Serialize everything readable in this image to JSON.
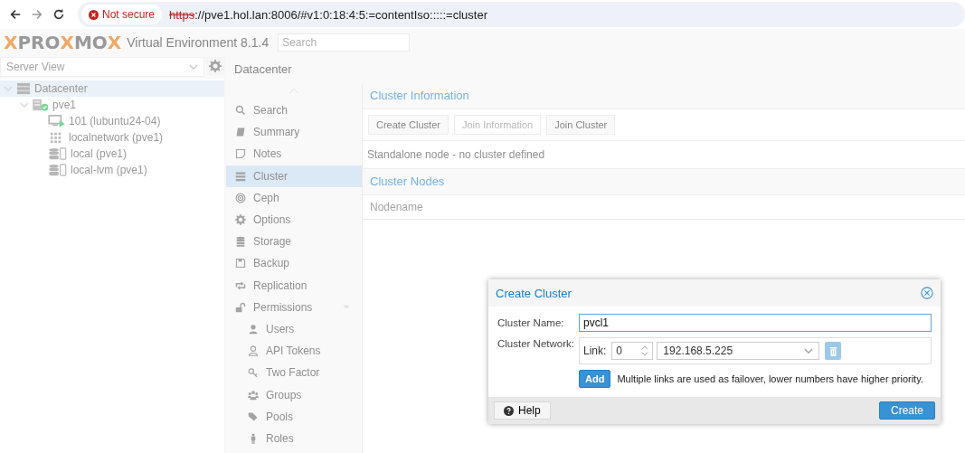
{
  "browser": {
    "security": "Not secure",
    "url_scheme": "https",
    "url_rest": "://pve1.hol.lan:8006/#v1:0:18:4:5:=contentIso:::::=cluster"
  },
  "header": {
    "logo": [
      {
        "text": "X",
        "accent": true
      },
      {
        "text": "PRO",
        "accent": false
      },
      {
        "text": "X",
        "accent": true
      },
      {
        "text": "MO",
        "accent": false
      },
      {
        "text": "X",
        "accent": true
      }
    ],
    "product": "Virtual Environment 8.1.4",
    "search": {
      "placeholder": "Search"
    }
  },
  "sidebar": {
    "view": "Server View",
    "tree": [
      {
        "label": "Datacenter",
        "kind": "datacenter",
        "selected": true,
        "expanded": true,
        "children": [
          {
            "label": "pve1",
            "kind": "node",
            "selected": false,
            "expanded": true,
            "children": [
              {
                "label": "101 (lubuntu24-04)",
                "kind": "vm",
                "selected": false
              },
              {
                "label": "localnetwork (pve1)",
                "kind": "sdn",
                "selected": false
              },
              {
                "label": "local (pve1)",
                "kind": "storage",
                "selected": false
              },
              {
                "label": "local-lvm (pve1)",
                "kind": "storage",
                "selected": false
              }
            ]
          }
        ]
      }
    ]
  },
  "breadcrumb": "Datacenter",
  "nav": [
    {
      "label": "Search",
      "kind": "search",
      "selected": false
    },
    {
      "label": "Summary",
      "kind": "book",
      "selected": false
    },
    {
      "label": "Notes",
      "kind": "note",
      "selected": false
    },
    {
      "label": "Cluster",
      "kind": "server",
      "selected": true
    },
    {
      "label": "Ceph",
      "kind": "ceph",
      "selected": false
    },
    {
      "label": "Options",
      "kind": "gear",
      "selected": false
    },
    {
      "label": "Storage",
      "kind": "database",
      "selected": false
    },
    {
      "label": "Backup",
      "kind": "floppy",
      "selected": false
    },
    {
      "label": "Replication",
      "kind": "retweet",
      "selected": false
    },
    {
      "label": "Permissions",
      "kind": "unlock",
      "selected": false,
      "expanded": true,
      "children": [
        {
          "label": "Users",
          "kind": "user",
          "selected": false
        },
        {
          "label": "API Tokens",
          "kind": "useroutline",
          "selected": false
        },
        {
          "label": "Two Factor",
          "kind": "key",
          "selected": false
        },
        {
          "label": "Groups",
          "kind": "users",
          "selected": false
        },
        {
          "label": "Pools",
          "kind": "tags",
          "selected": false
        },
        {
          "label": "Roles",
          "kind": "male",
          "selected": false
        }
      ]
    }
  ],
  "cluster_information": {
    "title": "Cluster Information",
    "buttons": [
      {
        "label": "Create Cluster",
        "disabled": false
      },
      {
        "label": "Join Information",
        "disabled": true
      },
      {
        "label": "Join Cluster",
        "disabled": false
      }
    ],
    "status": "Standalone node - no cluster defined"
  },
  "cluster_nodes": {
    "title": "Cluster Nodes",
    "columns": [
      "Nodename"
    ]
  },
  "dialog": {
    "title": "Create Cluster",
    "cluster_name_label": "Cluster Name:",
    "cluster_name": "pvcl1",
    "network_label": "Cluster Network:",
    "link_label": "Link:",
    "link_number": "0",
    "link_address": "192.168.5.225",
    "add_button": "Add",
    "hint": "Multiple links are used as failover, lower numbers have higher priority.",
    "help_button": "Help",
    "create_button": "Create"
  }
}
